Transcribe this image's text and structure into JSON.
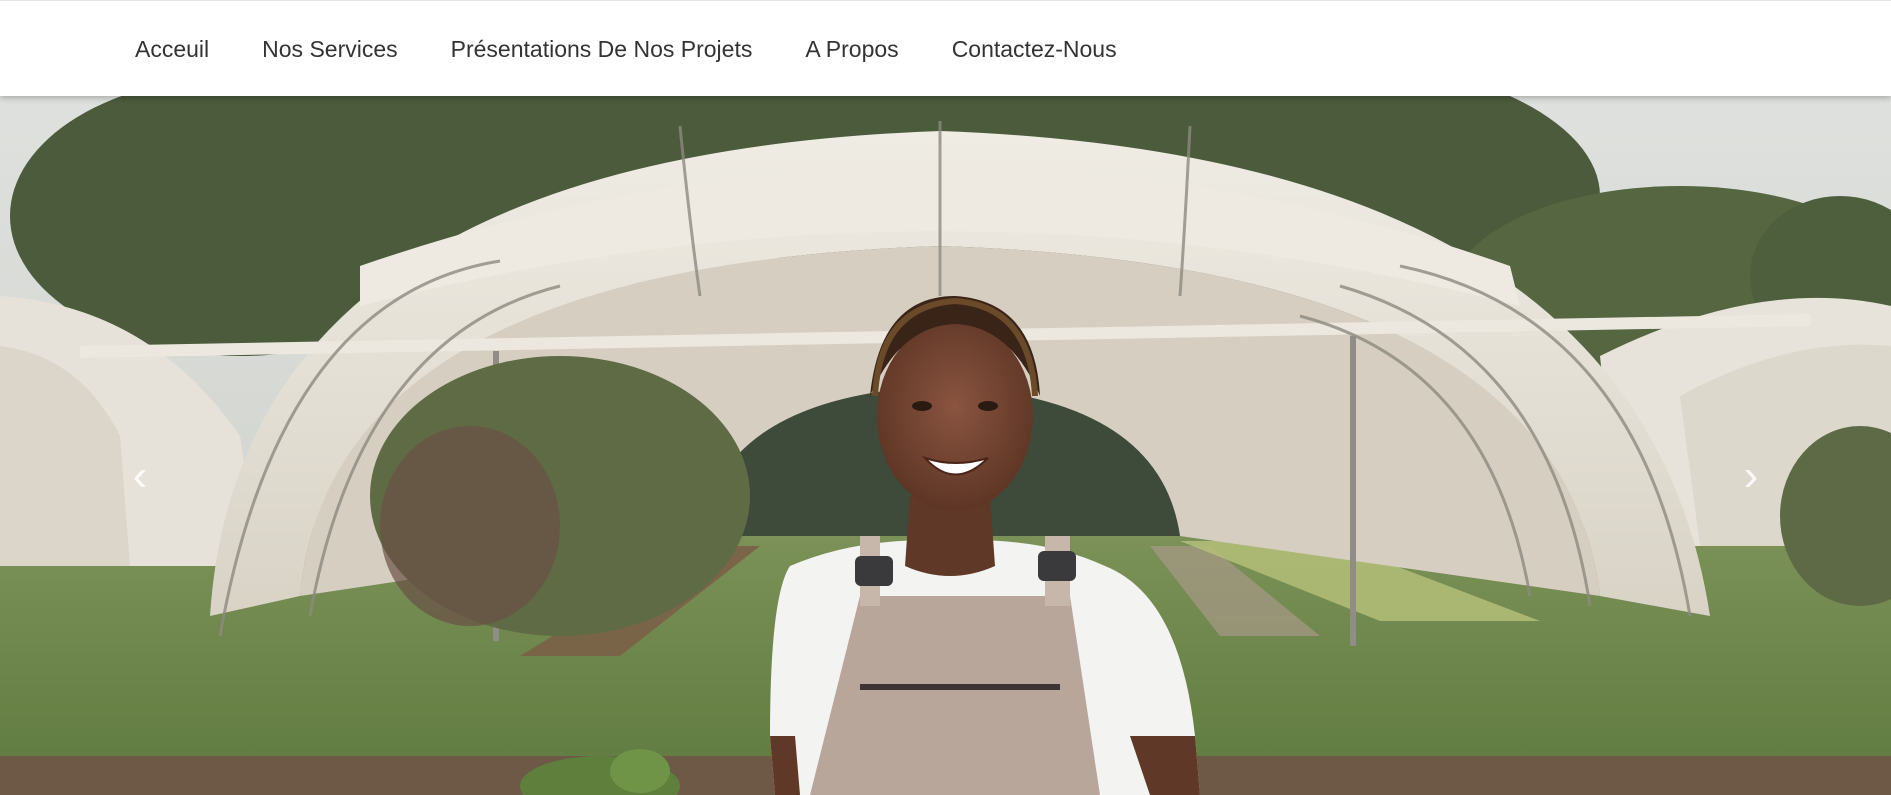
{
  "nav": {
    "items": [
      {
        "label": "Acceuil"
      },
      {
        "label": "Nos Services"
      },
      {
        "label": "Présentations De Nos Projets"
      },
      {
        "label": "A Propos"
      },
      {
        "label": "Contactez-Nous"
      }
    ]
  },
  "carousel": {
    "prev_icon": "chevron-left-icon",
    "next_icon": "chevron-right-icon",
    "prev_glyph": "‹",
    "next_glyph": "›"
  },
  "colors": {
    "sky": "#d9dcd8",
    "foliage": "#4a5a3a",
    "greenhouse": "#e9e5dc",
    "grass": "#6f8b4b",
    "soil": "#7a5a43",
    "apron": "#bba89c",
    "shirt": "#f4f4f2",
    "skin": "#6b4130"
  }
}
